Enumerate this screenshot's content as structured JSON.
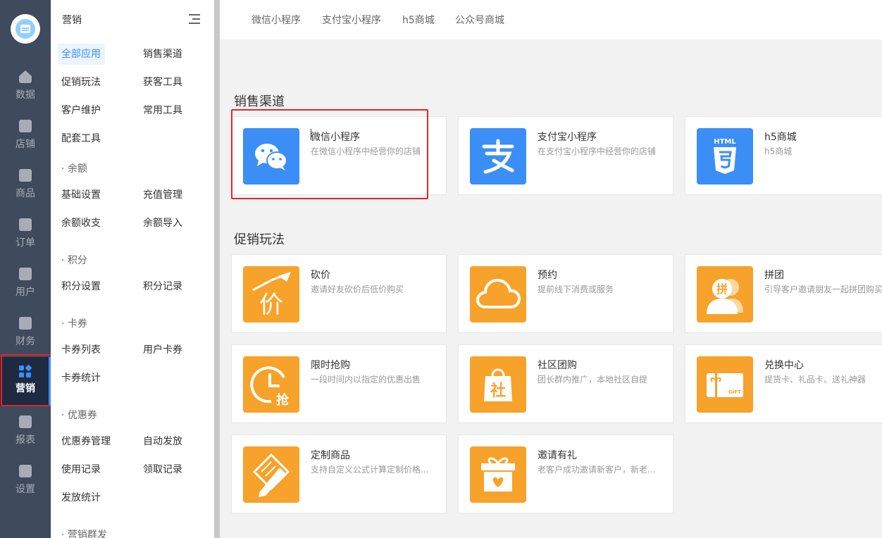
{
  "rail": {
    "items": [
      {
        "label": "数据",
        "icon": "home-icon"
      },
      {
        "label": "店铺",
        "icon": "store-icon"
      },
      {
        "label": "商品",
        "icon": "bag-icon"
      },
      {
        "label": "订单",
        "icon": "order-icon"
      },
      {
        "label": "用户",
        "icon": "user-icon"
      },
      {
        "label": "财务",
        "icon": "money-icon"
      },
      {
        "label": "营销",
        "icon": "apps-icon"
      },
      {
        "label": "报表",
        "icon": "chart-icon"
      },
      {
        "label": "设置",
        "icon": "gear-icon"
      }
    ],
    "active": "营销"
  },
  "menu": {
    "title": "营销",
    "items": [
      {
        "label": "全部应用",
        "selected": true
      },
      {
        "label": "销售渠道"
      },
      {
        "label": "促销玩法"
      },
      {
        "label": "获客工具"
      },
      {
        "label": "客户维护"
      },
      {
        "label": "常用工具"
      },
      {
        "label": "配套工具"
      }
    ],
    "sections": [
      {
        "title": "· 余额",
        "items": [
          "基础设置",
          "充值管理",
          "余额收支",
          "余额导入"
        ]
      },
      {
        "title": "· 积分",
        "items": [
          "积分设置",
          "积分记录"
        ]
      },
      {
        "title": "· 卡券",
        "items": [
          "卡券列表",
          "用户卡券",
          "卡券统计"
        ]
      },
      {
        "title": "· 优惠券",
        "items": [
          "优惠券管理",
          "自动发放",
          "使用记录",
          "领取记录",
          "发放统计"
        ]
      },
      {
        "title": "· 营销群发",
        "items": []
      }
    ]
  },
  "top_tabs": [
    "微信小程序",
    "支付宝小程序",
    "h5商城",
    "公众号商城"
  ],
  "sales_channels": {
    "title": "销售渠道",
    "cards": [
      {
        "name": "微信小程序",
        "desc": "在微信小程序中经营你的店铺",
        "icon": "wechat-icon"
      },
      {
        "name": "支付宝小程序",
        "desc": "在支付宝小程序中经营你的店铺",
        "icon": "alipay-icon"
      },
      {
        "name": "h5商城",
        "desc": "h5商城",
        "icon": "html5-icon",
        "html_label": "HTML"
      }
    ]
  },
  "promotions": {
    "title": "促销玩法",
    "cards": [
      {
        "name": "砍价",
        "desc": "邀请好友砍价后低价购买",
        "icon": "bargain-icon",
        "glyph": "价"
      },
      {
        "name": "预约",
        "desc": "提前线下消费或服务",
        "icon": "cloud-icon"
      },
      {
        "name": "拼团",
        "desc": "引导客户邀请朋友一起拼团购买",
        "icon": "group-buy-icon",
        "glyph": "拼"
      },
      {
        "name": "限时抢购",
        "desc": "一段时间内以指定的优惠出售",
        "icon": "flash-sale-icon",
        "glyph": "抢"
      },
      {
        "name": "社区团购",
        "desc": "团长群内推广，本地社区自提",
        "icon": "community-icon",
        "glyph": "社"
      },
      {
        "name": "兑换中心",
        "desc": "提货卡、礼品卡、送礼神器",
        "icon": "gift-card-icon",
        "glyph": "GIFT"
      },
      {
        "name": "定制商品",
        "desc": "支持自定义公式计算定制价格...",
        "icon": "custom-icon"
      },
      {
        "name": "邀请有礼",
        "desc": "老客户成功邀请新客户，新老...",
        "icon": "invite-gift-icon"
      }
    ]
  },
  "colors": {
    "rail_bg": "#3f4a5c",
    "accent": "#3c8dff",
    "orange": "#f7a22a",
    "blue_icon": "#3b8ef5",
    "highlight": "#e0262b"
  }
}
